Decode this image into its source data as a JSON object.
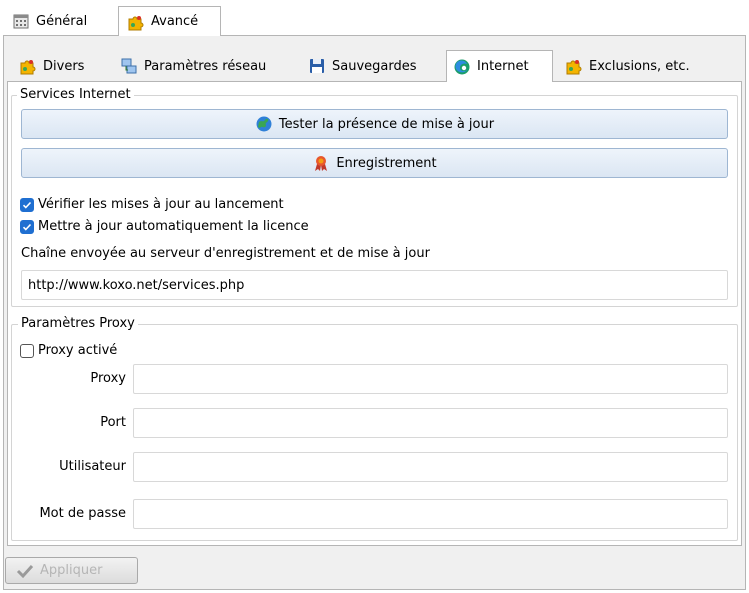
{
  "top_tabs": [
    {
      "label": "Général",
      "icon": "calendar-icon",
      "active": false
    },
    {
      "label": "Avancé",
      "icon": "puzzle-icon",
      "active": true
    }
  ],
  "inner_tabs": [
    {
      "label": "Divers",
      "icon": "puzzle-icon",
      "active": false
    },
    {
      "label": "Paramètres réseau",
      "icon": "network-icon",
      "active": false
    },
    {
      "label": "Sauvegardes",
      "icon": "floppy-disk-icon",
      "active": false
    },
    {
      "label": "Internet",
      "icon": "browser-icon",
      "active": true
    },
    {
      "label": "Exclusions, etc.",
      "icon": "puzzle-icon",
      "active": false
    }
  ],
  "services": {
    "title": "Services Internet",
    "test_button": "Tester la présence de mise à jour",
    "register_button": "Enregistrement",
    "check_updates_label": "Vérifier les mises à jour au lancement",
    "check_updates_checked": true,
    "auto_license_label": "Mettre à jour automatiquement la licence",
    "auto_license_checked": true,
    "url_caption": "Chaîne envoyée au serveur d'enregistrement et de mise à jour",
    "url_value": "http://www.koxo.net/services.php"
  },
  "proxy": {
    "title": "Paramètres Proxy",
    "enabled_label": "Proxy activé",
    "enabled_checked": false,
    "proxy_label": "Proxy",
    "proxy_value": "",
    "port_label": "Port",
    "port_value": "",
    "user_label": "Utilisateur",
    "user_value": "",
    "password_label": "Mot de passe",
    "password_value": ""
  },
  "apply_button": "Appliquer",
  "colors": {
    "accent": "#1f6fd1",
    "button_border": "#9eb6d2",
    "panel_bg": "#f0f0f0"
  }
}
